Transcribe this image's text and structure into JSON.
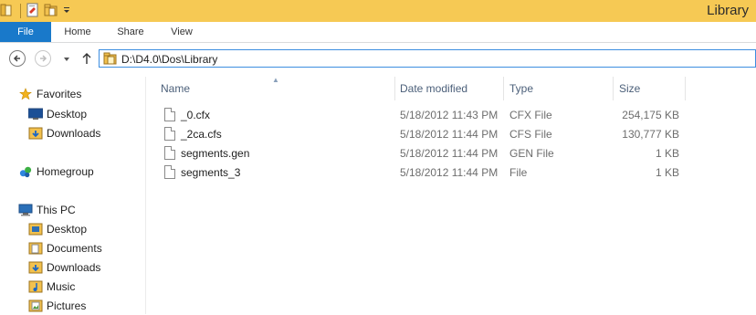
{
  "window": {
    "title": "Library",
    "colors": {
      "titlebar": "#f6c954",
      "file_tab": "#1979ca",
      "accent_border": "#3d8ee0"
    }
  },
  "quick_access": {
    "icons": [
      "folder-icon",
      "properties-icon",
      "new-folder-icon",
      "customize-dropdown-icon"
    ]
  },
  "ribbon": {
    "tabs": [
      "File",
      "Home",
      "Share",
      "View"
    ]
  },
  "address_bar": {
    "path": "D:\\D4.0\\Dos\\Library",
    "icons": [
      "back-arrow-icon",
      "forward-arrow-icon",
      "recent-locations-icon",
      "up-arrow-icon",
      "folder-icon"
    ]
  },
  "nav_pane": {
    "favorites": {
      "label": "Favorites",
      "items": [
        "Desktop",
        "Downloads"
      ]
    },
    "homegroup": {
      "label": "Homegroup"
    },
    "this_pc": {
      "label": "This PC",
      "items": [
        "Desktop",
        "Documents",
        "Downloads",
        "Music",
        "Pictures"
      ]
    }
  },
  "file_list": {
    "columns": [
      "Name",
      "Date modified",
      "Type",
      "Size"
    ],
    "rows": [
      {
        "name": "_0.cfx",
        "date": "5/18/2012 11:43 PM",
        "type": "CFX File",
        "size": "254,175 KB"
      },
      {
        "name": "_2ca.cfs",
        "date": "5/18/2012 11:44 PM",
        "type": "CFS File",
        "size": "130,777 KB"
      },
      {
        "name": "segments.gen",
        "date": "5/18/2012 11:44 PM",
        "type": "GEN File",
        "size": "1 KB"
      },
      {
        "name": "segments_3",
        "date": "5/18/2012 11:44 PM",
        "type": "File",
        "size": "1 KB"
      }
    ]
  }
}
